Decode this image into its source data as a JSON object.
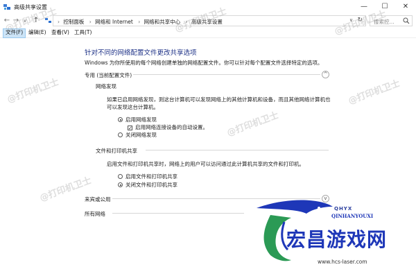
{
  "window": {
    "title": "高级共享设置",
    "minimize": "—",
    "maximize": "☐",
    "close": "✕"
  },
  "nav": {
    "back": "←",
    "forward": "→",
    "recent": "∨",
    "up": "↑",
    "refresh": "↻",
    "dropdown": "∨"
  },
  "breadcrumb": {
    "items": [
      "控制面板",
      "网络和 Internet",
      "网络和共享中心",
      "高级共享设置"
    ],
    "separator": "›",
    "lead": "›"
  },
  "search": {
    "placeholder": "搜索控..."
  },
  "menu": {
    "file": "文件(F)",
    "edit": "编辑(E)",
    "view": "查看(V)",
    "tools": "工具(T)"
  },
  "main": {
    "heading": "针对不同的网络配置文件更改共享选项",
    "description": "Windows 为你所使用的每个网络创建单独的网络配置文件。你可以针对每个配置文件选择特定的选项。",
    "private_profile": "专用 (当前配置文件)",
    "network_discovery": {
      "title": "网络发现",
      "desc_line1": "如果已启用网络发现，则这台计算机可以发现网络上的其他计算机和设备，而且其他网络计算机也",
      "desc_line2": "可以发现这台计算机。",
      "opt_on": "启用网络发现",
      "opt_auto": "启用网络连接设备的自动设置。",
      "opt_off": "关闭网络发现",
      "selected": "on",
      "auto_checked": true
    },
    "file_sharing": {
      "title": "文件和打印机共享",
      "desc": "启用文件和打印机共享时，网络上的用户可以访问通过此计算机共享的文件和打印机。",
      "opt_on": "启用文件和打印机共享",
      "opt_off": "关闭文件和打印机共享",
      "selected": "off"
    },
    "guest_public": "来宾或公用",
    "all_networks": "所有网络"
  },
  "watermark": "@打印机卫士",
  "logo": {
    "badge": "QHYX",
    "english": "QINHANYOUXI",
    "chinese": "宏昌游戏网",
    "url": "www.hcs-laser.com"
  },
  "colors": {
    "heading": "#1e3287",
    "accent": "#1e37b8",
    "menu_active": "#cce4f7"
  }
}
